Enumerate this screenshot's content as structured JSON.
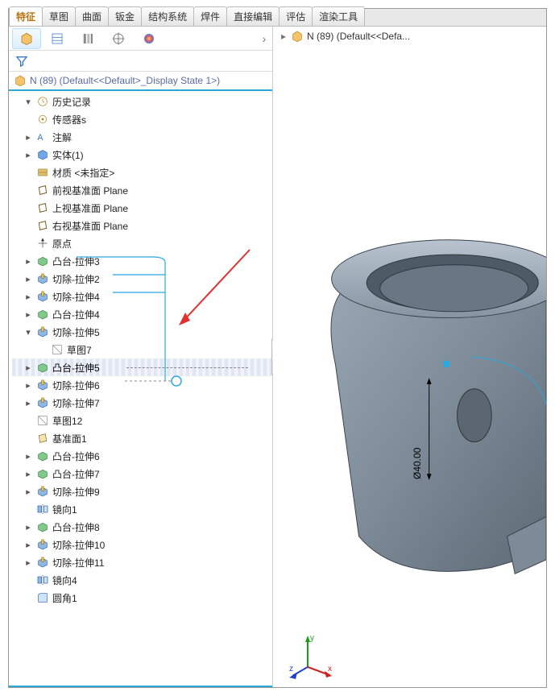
{
  "tabs": {
    "items": [
      "特征",
      "草图",
      "曲面",
      "钣金",
      "结构系统",
      "焊件",
      "直接编辑",
      "评估",
      "渲染工具"
    ],
    "active_index": 0
  },
  "panel": {
    "panel_icons": [
      "part-icon",
      "property-icon",
      "config-icon",
      "dimxpert-icon",
      "appearance-icon"
    ],
    "header_icon": "part-icon",
    "header_text": "N (89)  (Default<<Default>_Display State 1>)"
  },
  "tree": [
    {
      "exp": "▾",
      "kind": "history",
      "label": "历史记录",
      "indent": 0
    },
    {
      "exp": "",
      "kind": "sensor",
      "label": "传感器s",
      "indent": 0
    },
    {
      "exp": "▸",
      "kind": "annotation",
      "label": "注解",
      "indent": 0
    },
    {
      "exp": "▸",
      "kind": "solid",
      "label": "实体(1)",
      "indent": 0
    },
    {
      "exp": "",
      "kind": "material",
      "label": "材质 <未指定>",
      "indent": 0
    },
    {
      "exp": "",
      "kind": "plane",
      "label": "前视基准面 Plane",
      "indent": 0
    },
    {
      "exp": "",
      "kind": "plane",
      "label": "上视基准面 Plane",
      "indent": 0
    },
    {
      "exp": "",
      "kind": "plane",
      "label": "右视基准面 Plane",
      "indent": 0
    },
    {
      "exp": "",
      "kind": "origin",
      "label": "原点",
      "indent": 0
    },
    {
      "exp": "▸",
      "kind": "boss",
      "label": "凸台-拉伸3",
      "indent": 0
    },
    {
      "exp": "▸",
      "kind": "cut",
      "label": "切除-拉伸2",
      "indent": 0
    },
    {
      "exp": "▸",
      "kind": "cut",
      "label": "切除-拉伸4",
      "indent": 0
    },
    {
      "exp": "▸",
      "kind": "boss",
      "label": "凸台-拉伸4",
      "indent": 0
    },
    {
      "exp": "▾",
      "kind": "cut",
      "label": "切除-拉伸5",
      "indent": 0
    },
    {
      "exp": "",
      "kind": "sketch",
      "label": "草图7",
      "indent": 1
    },
    {
      "exp": "▸",
      "kind": "boss",
      "label": "凸台-拉伸5",
      "indent": 0,
      "selected": true
    },
    {
      "exp": "▸",
      "kind": "cut",
      "label": "切除-拉伸6",
      "indent": 0
    },
    {
      "exp": "▸",
      "kind": "cut",
      "label": "切除-拉伸7",
      "indent": 0
    },
    {
      "exp": "",
      "kind": "sketch",
      "label": "草图12",
      "indent": 0
    },
    {
      "exp": "",
      "kind": "plane2",
      "label": "基准面1",
      "indent": 0
    },
    {
      "exp": "▸",
      "kind": "boss",
      "label": "凸台-拉伸6",
      "indent": 0
    },
    {
      "exp": "▸",
      "kind": "boss",
      "label": "凸台-拉伸7",
      "indent": 0
    },
    {
      "exp": "▸",
      "kind": "cut",
      "label": "切除-拉伸9",
      "indent": 0
    },
    {
      "exp": "",
      "kind": "mirror",
      "label": "镜向1",
      "indent": 0
    },
    {
      "exp": "▸",
      "kind": "boss",
      "label": "凸台-拉伸8",
      "indent": 0
    },
    {
      "exp": "▸",
      "kind": "cut",
      "label": "切除-拉伸10",
      "indent": 0
    },
    {
      "exp": "▸",
      "kind": "cut",
      "label": "切除-拉伸11",
      "indent": 0
    },
    {
      "exp": "",
      "kind": "mirror",
      "label": "镜向4",
      "indent": 0
    },
    {
      "exp": "",
      "kind": "fillet",
      "label": "圆角1",
      "indent": 0
    }
  ],
  "viewport": {
    "breadcrumb_icon": "part-icon",
    "breadcrumb_text": "N (89)  (Default<<Defa...",
    "dimension_text": "Ø40.00",
    "triad_labels": {
      "x": "x",
      "y": "y",
      "z": "z"
    }
  }
}
